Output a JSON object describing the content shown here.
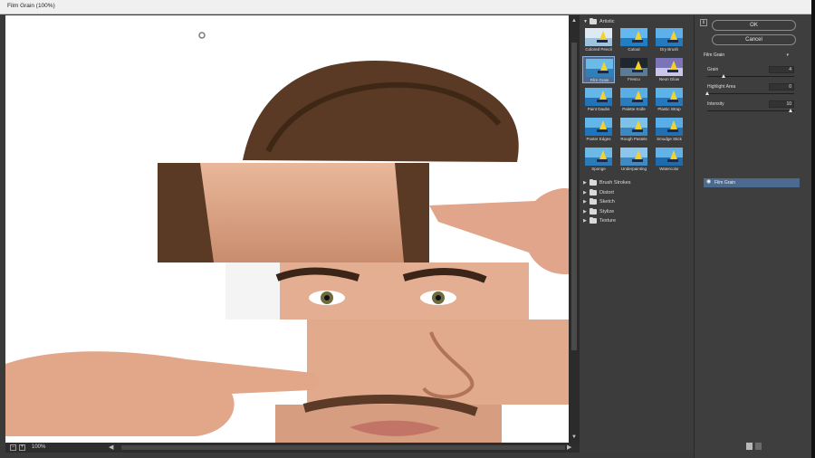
{
  "window": {
    "title": "Film Grain (100%)"
  },
  "preview": {
    "zoom_label": "100%",
    "zoom_out": "−",
    "zoom_in": "+"
  },
  "gallery": {
    "open_folder": "Artistic",
    "thumbnails": [
      {
        "label": "Colored Pencil",
        "selected": false,
        "sky": "#dfe9f2",
        "sea": "#9fc3dd"
      },
      {
        "label": "Cutout",
        "selected": false,
        "sky": "#65b7ef",
        "sea": "#1f7ec4"
      },
      {
        "label": "Dry Brush",
        "selected": false,
        "sky": "#5fb0ea",
        "sea": "#2579bd"
      },
      {
        "label": "Film Grain",
        "selected": true,
        "sky": "#6bbbe8",
        "sea": "#2f7fb8"
      },
      {
        "label": "Fresco",
        "selected": false,
        "sky": "#20262e",
        "sea": "#5c7b94"
      },
      {
        "label": "Neon Glow",
        "selected": false,
        "sky": "#7b74b8",
        "sea": "#c9c6ea"
      },
      {
        "label": "Paint Daubs",
        "selected": false,
        "sky": "#66b7e9",
        "sea": "#2374b7"
      },
      {
        "label": "Palette Knife",
        "selected": false,
        "sky": "#5aaee4",
        "sea": "#2b7cbd"
      },
      {
        "label": "Plastic Wrap",
        "selected": false,
        "sky": "#5db3e8",
        "sea": "#2578bb"
      },
      {
        "label": "Poster Edges",
        "selected": false,
        "sky": "#63b6ea",
        "sea": "#1f75bc"
      },
      {
        "label": "Rough Pastels",
        "selected": false,
        "sky": "#7ec2ea",
        "sea": "#3c88c2"
      },
      {
        "label": "Smudge Stick",
        "selected": false,
        "sky": "#5aaee8",
        "sea": "#236fb1"
      },
      {
        "label": "Sponge",
        "selected": false,
        "sky": "#6cb9e6",
        "sea": "#2c7bb9"
      },
      {
        "label": "Underpainting",
        "selected": false,
        "sky": "#8cc6ec",
        "sea": "#3f8ac3"
      },
      {
        "label": "Watercolor",
        "selected": false,
        "sky": "#62b2e7",
        "sea": "#1d6aad"
      }
    ],
    "folders": [
      "Brush Strokes",
      "Distort",
      "Sketch",
      "Stylize",
      "Texture"
    ]
  },
  "panel": {
    "ok_label": "OK",
    "cancel_label": "Cancel",
    "filter_name": "Film Grain",
    "params": [
      {
        "label": "Grain",
        "value": "4",
        "fraction": 0.2
      },
      {
        "label": "Highlight Area",
        "value": "0",
        "fraction": 0.0
      },
      {
        "label": "Intensity",
        "value": "10",
        "fraction": 1.0
      }
    ],
    "effect_layer": "Film Grain"
  },
  "colors": {
    "selected_accent": "#4f6a8e",
    "panel_bg": "#3e3e3e",
    "canvas_bg": "#ffffff"
  }
}
